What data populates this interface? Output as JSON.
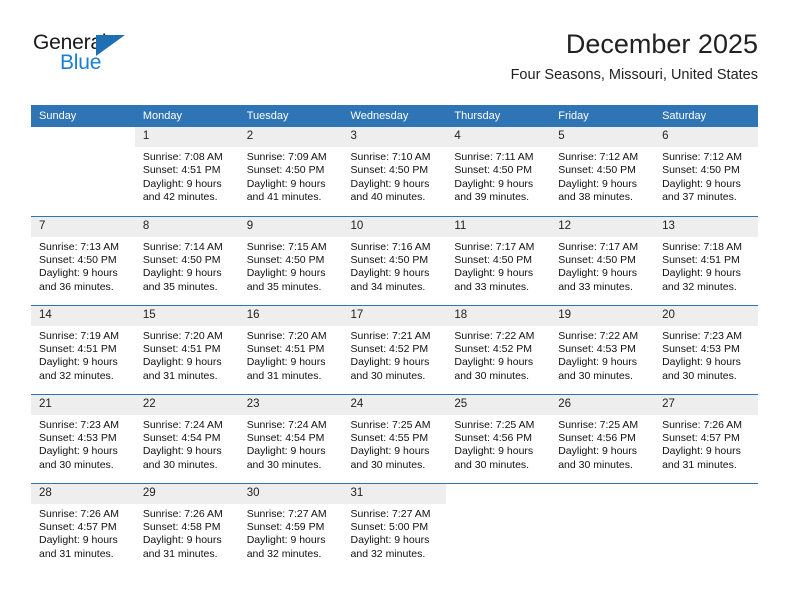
{
  "brand": {
    "name_part1": "General",
    "name_part2": "Blue",
    "accent_color": "#1f6fb5",
    "text_blue": "#1a7fd4"
  },
  "header": {
    "title": "December 2025",
    "subtitle": "Four Seasons, Missouri, United States",
    "header_bg_color": "#2f74b5"
  },
  "weekdays": [
    "Sunday",
    "Monday",
    "Tuesday",
    "Wednesday",
    "Thursday",
    "Friday",
    "Saturday"
  ],
  "weeks": [
    [
      {
        "day": "",
        "info": ""
      },
      {
        "day": "1",
        "info": "Sunrise: 7:08 AM\nSunset: 4:51 PM\nDaylight: 9 hours\nand 42 minutes."
      },
      {
        "day": "2",
        "info": "Sunrise: 7:09 AM\nSunset: 4:50 PM\nDaylight: 9 hours\nand 41 minutes."
      },
      {
        "day": "3",
        "info": "Sunrise: 7:10 AM\nSunset: 4:50 PM\nDaylight: 9 hours\nand 40 minutes."
      },
      {
        "day": "4",
        "info": "Sunrise: 7:11 AM\nSunset: 4:50 PM\nDaylight: 9 hours\nand 39 minutes."
      },
      {
        "day": "5",
        "info": "Sunrise: 7:12 AM\nSunset: 4:50 PM\nDaylight: 9 hours\nand 38 minutes."
      },
      {
        "day": "6",
        "info": "Sunrise: 7:12 AM\nSunset: 4:50 PM\nDaylight: 9 hours\nand 37 minutes."
      }
    ],
    [
      {
        "day": "7",
        "info": "Sunrise: 7:13 AM\nSunset: 4:50 PM\nDaylight: 9 hours\nand 36 minutes."
      },
      {
        "day": "8",
        "info": "Sunrise: 7:14 AM\nSunset: 4:50 PM\nDaylight: 9 hours\nand 35 minutes."
      },
      {
        "day": "9",
        "info": "Sunrise: 7:15 AM\nSunset: 4:50 PM\nDaylight: 9 hours\nand 35 minutes."
      },
      {
        "day": "10",
        "info": "Sunrise: 7:16 AM\nSunset: 4:50 PM\nDaylight: 9 hours\nand 34 minutes."
      },
      {
        "day": "11",
        "info": "Sunrise: 7:17 AM\nSunset: 4:50 PM\nDaylight: 9 hours\nand 33 minutes."
      },
      {
        "day": "12",
        "info": "Sunrise: 7:17 AM\nSunset: 4:50 PM\nDaylight: 9 hours\nand 33 minutes."
      },
      {
        "day": "13",
        "info": "Sunrise: 7:18 AM\nSunset: 4:51 PM\nDaylight: 9 hours\nand 32 minutes."
      }
    ],
    [
      {
        "day": "14",
        "info": "Sunrise: 7:19 AM\nSunset: 4:51 PM\nDaylight: 9 hours\nand 32 minutes."
      },
      {
        "day": "15",
        "info": "Sunrise: 7:20 AM\nSunset: 4:51 PM\nDaylight: 9 hours\nand 31 minutes."
      },
      {
        "day": "16",
        "info": "Sunrise: 7:20 AM\nSunset: 4:51 PM\nDaylight: 9 hours\nand 31 minutes."
      },
      {
        "day": "17",
        "info": "Sunrise: 7:21 AM\nSunset: 4:52 PM\nDaylight: 9 hours\nand 30 minutes."
      },
      {
        "day": "18",
        "info": "Sunrise: 7:22 AM\nSunset: 4:52 PM\nDaylight: 9 hours\nand 30 minutes."
      },
      {
        "day": "19",
        "info": "Sunrise: 7:22 AM\nSunset: 4:53 PM\nDaylight: 9 hours\nand 30 minutes."
      },
      {
        "day": "20",
        "info": "Sunrise: 7:23 AM\nSunset: 4:53 PM\nDaylight: 9 hours\nand 30 minutes."
      }
    ],
    [
      {
        "day": "21",
        "info": "Sunrise: 7:23 AM\nSunset: 4:53 PM\nDaylight: 9 hours\nand 30 minutes."
      },
      {
        "day": "22",
        "info": "Sunrise: 7:24 AM\nSunset: 4:54 PM\nDaylight: 9 hours\nand 30 minutes."
      },
      {
        "day": "23",
        "info": "Sunrise: 7:24 AM\nSunset: 4:54 PM\nDaylight: 9 hours\nand 30 minutes."
      },
      {
        "day": "24",
        "info": "Sunrise: 7:25 AM\nSunset: 4:55 PM\nDaylight: 9 hours\nand 30 minutes."
      },
      {
        "day": "25",
        "info": "Sunrise: 7:25 AM\nSunset: 4:56 PM\nDaylight: 9 hours\nand 30 minutes."
      },
      {
        "day": "26",
        "info": "Sunrise: 7:25 AM\nSunset: 4:56 PM\nDaylight: 9 hours\nand 30 minutes."
      },
      {
        "day": "27",
        "info": "Sunrise: 7:26 AM\nSunset: 4:57 PM\nDaylight: 9 hours\nand 31 minutes."
      }
    ],
    [
      {
        "day": "28",
        "info": "Sunrise: 7:26 AM\nSunset: 4:57 PM\nDaylight: 9 hours\nand 31 minutes."
      },
      {
        "day": "29",
        "info": "Sunrise: 7:26 AM\nSunset: 4:58 PM\nDaylight: 9 hours\nand 31 minutes."
      },
      {
        "day": "30",
        "info": "Sunrise: 7:27 AM\nSunset: 4:59 PM\nDaylight: 9 hours\nand 32 minutes."
      },
      {
        "day": "31",
        "info": "Sunrise: 7:27 AM\nSunset: 5:00 PM\nDaylight: 9 hours\nand 32 minutes."
      },
      {
        "day": "",
        "info": ""
      },
      {
        "day": "",
        "info": ""
      },
      {
        "day": "",
        "info": ""
      }
    ]
  ]
}
